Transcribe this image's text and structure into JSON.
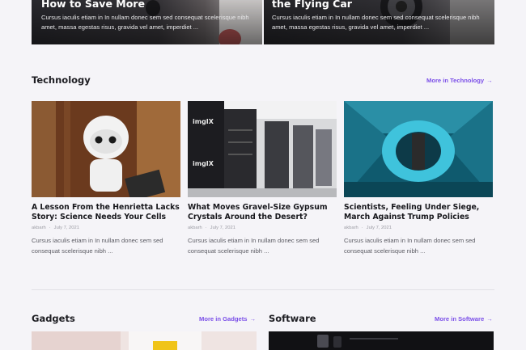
{
  "hero": [
    {
      "title": "How to Save More",
      "text": "Cursus iaculis etiam in In nullam donec sem sed consequat scelerisque nibh amet, massa egestas risus, gravida vel amet, imperdiet ..."
    },
    {
      "title": "the Flying Car",
      "text": "Cursus iaculis etiam in In nullam donec sem sed consequat scelerisque nibh amet, massa egestas risus, gravida vel amet, imperdiet ..."
    }
  ],
  "technology": {
    "title": "Technology",
    "more": "More in Technology",
    "arrow": "→",
    "posts": [
      {
        "title": "A Lesson From the Henrietta Lacks Story: Science Needs Your Cells",
        "author": "akbarh",
        "date": "July 7, 2021",
        "excerpt": "Cursus iaculis etiam in In nullam donec sem sed consequat scelerisque nibh ..."
      },
      {
        "title": "What Moves Gravel-Size Gypsum Crystals Around the Desert?",
        "author": "akbarh",
        "date": "July 7, 2021",
        "excerpt": "Cursus iaculis etiam in In nullam donec sem sed consequat scelerisque nibh ..."
      },
      {
        "title": "Scientists, Feeling Under Siege, March Against Trump Policies",
        "author": "akbarh",
        "date": "July 7, 2021",
        "excerpt": "Cursus iaculis etiam in In nullam donec sem sed consequat scelerisque nibh ..."
      }
    ],
    "server_logo": "imgIX"
  },
  "gadgets": {
    "title": "Gadgets",
    "more": "More in Gadgets",
    "arrow": "→"
  },
  "software": {
    "title": "Software",
    "more": "More in Software",
    "arrow": "→"
  }
}
